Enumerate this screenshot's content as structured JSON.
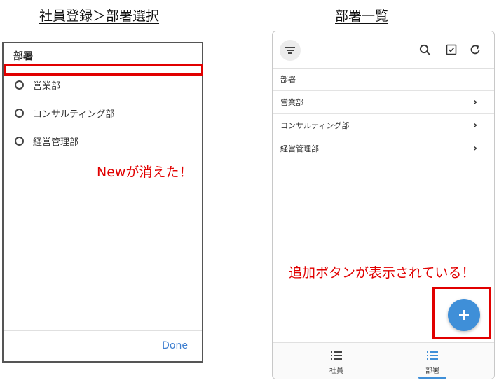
{
  "captions": {
    "left": "社員登録＞部署選択",
    "right": "部署一覧"
  },
  "dialog": {
    "title": "部署",
    "options": [
      "営業部",
      "コンサルティング部",
      "経営管理部"
    ],
    "done_label": "Done"
  },
  "annotations": {
    "left_note": "Newが消えた！",
    "right_note": "追加ボタンが表示されている！",
    "color": "#e10000"
  },
  "list_screen": {
    "header_icons": [
      "menu-icon",
      "search-icon",
      "checkbox-icon",
      "refresh-icon"
    ],
    "list_header": "部署",
    "items": [
      "営業部",
      "コンサルティング部",
      "経営管理部"
    ],
    "chevron": "›",
    "fab_icon": "plus-icon",
    "nav": {
      "employee_label": "社員",
      "department_label": "部署"
    },
    "accent_color": "#3f8fd8"
  }
}
